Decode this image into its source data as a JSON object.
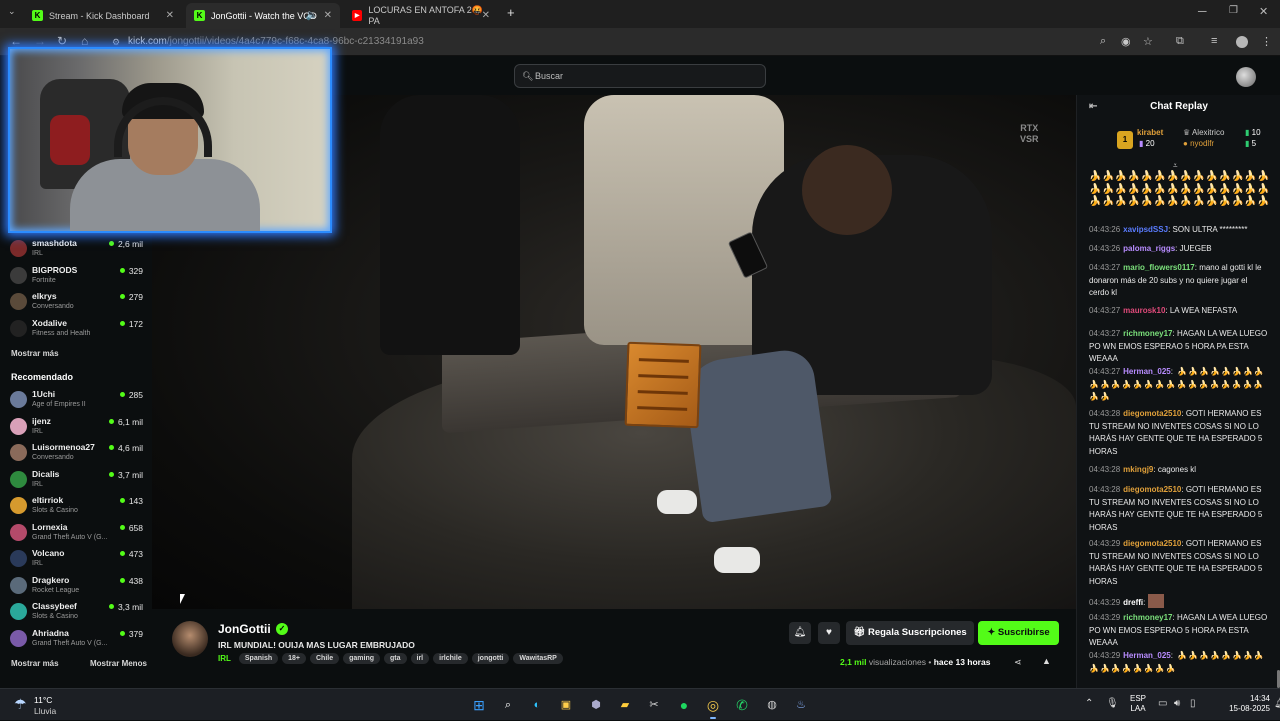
{
  "browser": {
    "tabs": [
      {
        "title": "Stream - Kick Dashboard",
        "active": false
      },
      {
        "title": "JonGottii - Watch the VOD",
        "active": true
      },
      {
        "title": "LOCURAS EN ANTOFA 2🤬 PA",
        "active": false
      }
    ],
    "url_host": "kick.com",
    "url_path": "/jongottii/videos/4a4c779c-f68c-4ca8-96bc-c21334191a93"
  },
  "header": {
    "search_placeholder": "Buscar"
  },
  "sidebar": {
    "following": [
      {
        "name": "smashdota",
        "category": "IRL",
        "viewers": "2,6 mil",
        "color": "#7b2a2a"
      },
      {
        "name": "BIGPRODS",
        "category": "Fortnite",
        "viewers": "329",
        "color": "#3b3b3b"
      },
      {
        "name": "elkrys",
        "category": "Conversando",
        "viewers": "279",
        "color": "#5a4a3a"
      },
      {
        "name": "Xodalive",
        "category": "Fitness and Health",
        "viewers": "172",
        "color": "#222222"
      }
    ],
    "show_more": "Mostrar más",
    "recommended_title": "Recomendado",
    "recommended": [
      {
        "name": "1Uchi",
        "category": "Age of Empires II",
        "viewers": "285",
        "color": "#6a7a9a"
      },
      {
        "name": "ijenz",
        "category": "IRL",
        "viewers": "6,1 mil",
        "color": "#d9a0b8"
      },
      {
        "name": "Luisormenoa27",
        "category": "Conversando",
        "viewers": "4,6 mil",
        "color": "#8a6a5a"
      },
      {
        "name": "Dicalis",
        "category": "IRL",
        "viewers": "3,7 mil",
        "color": "#2e8a3e"
      },
      {
        "name": "eltirriok",
        "category": "Slots & Casino",
        "viewers": "143",
        "color": "#d69a2e"
      },
      {
        "name": "Lornexia",
        "category": "Grand Theft Auto V (G...",
        "viewers": "658",
        "color": "#b44a6a"
      },
      {
        "name": "Volcano",
        "category": "IRL",
        "viewers": "473",
        "color": "#2a3a5a"
      },
      {
        "name": "Dragkero",
        "category": "Rocket League",
        "viewers": "438",
        "color": "#5a6a7a"
      },
      {
        "name": "Classybeef",
        "category": "Slots & Casino",
        "viewers": "3,3 mil",
        "color": "#2aa89a"
      },
      {
        "name": "Ahriadna",
        "category": "Grand Theft Auto V (G...",
        "viewers": "379",
        "color": "#7a5aa8"
      }
    ],
    "show_more_2": "Mostrar más",
    "show_less": "Mostrar Menos"
  },
  "video": {
    "badge_line1": "RTX",
    "badge_line2": "VSR"
  },
  "info": {
    "channel": "JonGottii",
    "title": "IRL MUNDIAL! OUIJA MAS LUGAR EMBRUJADO",
    "category": "IRL",
    "tags": [
      "Spanish",
      "18+",
      "Chile",
      "gaming",
      "gta",
      "irl",
      "irlchile",
      "jongotti",
      "WawitasRP"
    ],
    "gift_label": "Regala Suscripciones",
    "subscribe_label": "Suscribirse",
    "views_value": "2,1 mil",
    "views_word": "visualizaciones",
    "time_ago": "hace 13 horas"
  },
  "chat": {
    "title": "Chat Replay",
    "gifters": [
      {
        "name": "kirabet",
        "count": "20"
      },
      {
        "name": "Alexitrico",
        "count": "10"
      },
      {
        "name": "nyodlfr",
        "count": "5"
      }
    ],
    "rank_badge": "1",
    "pinned_emotes": [
      "🍌🍌🍌🍌🍌🍌🍌🍌🍌🍌🍌🍌🍌🍌",
      "🍌🍌🍌🍌🍌🍌🍌🍌🍌🍌🍌🍌🍌🍌",
      "🍌🍌🍌🍌🍌🍌🍌🍌🍌🍌🍌🍌🍌🍌"
    ],
    "messages": [
      {
        "time": "04:43:26",
        "user": "xavipsdSSJ",
        "color": "#5a7cff",
        "text": ": SON ULTRA *********"
      },
      {
        "time": "04:43:26",
        "user": "paloma_riggs",
        "color": "#b88cff",
        "text": ": JUEGEB"
      },
      {
        "time": "04:43:27",
        "user": "mario_flowers0117",
        "color": "#7be07b",
        "text": ": mano al gotti kl le donaron más de 20 subs y no quiere jugar el cerdo kl"
      },
      {
        "time": "04:43:27",
        "user": "maurosk10",
        "color": "#e04a7a",
        "text": ": LA WEA NEFASTA"
      },
      {
        "time": "04:43:27",
        "user": "richmoney17",
        "color": "#7be07b",
        "text": ": HAGAN LA WEA LUEGO PO WN EMOS ESPERAO 5 HORA PA ESTA WEAAA"
      },
      {
        "time": "04:43:27",
        "user": "Herman_025",
        "color": "#b88cff",
        "text": ": 🍌🍌🍌🍌🍌🍌🍌🍌🍌🍌🍌🍌🍌🍌🍌🍌🍌🍌🍌🍌🍌🍌🍌🍌🍌🍌"
      },
      {
        "time": "04:43:28",
        "user": "diegomota2510",
        "color": "#e0a03a",
        "text": ": GOTI HERMANO ES TU STREAM NO INVENTES COSAS SI NO LO HARÁS HAY GENTE QUE TE HA ESPERADO 5 HORAS"
      },
      {
        "time": "04:43:28",
        "user": "mkingj9",
        "color": "#e0a03a",
        "text": ": cagones kl"
      },
      {
        "time": "04:43:28",
        "user": "diegomota2510",
        "color": "#e0a03a",
        "text": ": GOTI HERMANO ES TU STREAM NO INVENTES COSAS SI NO LO HARÁS HAY GENTE QUE TE HA ESPERADO 5 HORAS"
      },
      {
        "time": "04:43:29",
        "user": "diegomota2510",
        "color": "#e0a03a",
        "text": ": GOTI HERMANO ES TU STREAM NO INVENTES COSAS SI NO LO HARÁS HAY GENTE QUE TE HA ESPERADO 5 HORAS"
      },
      {
        "time": "04:43:29",
        "user": "dreffi",
        "color": "#ffffff",
        "text": ":"
      },
      {
        "time": "04:43:29",
        "user": "richmoney17",
        "color": "#7be07b",
        "text": ": HAGAN LA WEA LUEGO PO WN EMOS ESPERAO 5 HORA PA ESTA WEAAA"
      },
      {
        "time": "04:43:29",
        "user": "Herman_025",
        "color": "#b88cff",
        "text": ": 🍌🍌🍌🍌🍌🍌🍌🍌🍌🍌🍌🍌🍌🍌🍌🍌"
      }
    ]
  },
  "taskbar": {
    "temp": "11°C",
    "weather": "Lluvia",
    "lang_1": "ESP",
    "lang_2": "LAA",
    "time": "14:34",
    "date": "15-08-2025"
  },
  "colors": {
    "kick_green": "#53fc18",
    "webcam_glow": "#2f7bff",
    "background": "#0b0e0f"
  }
}
